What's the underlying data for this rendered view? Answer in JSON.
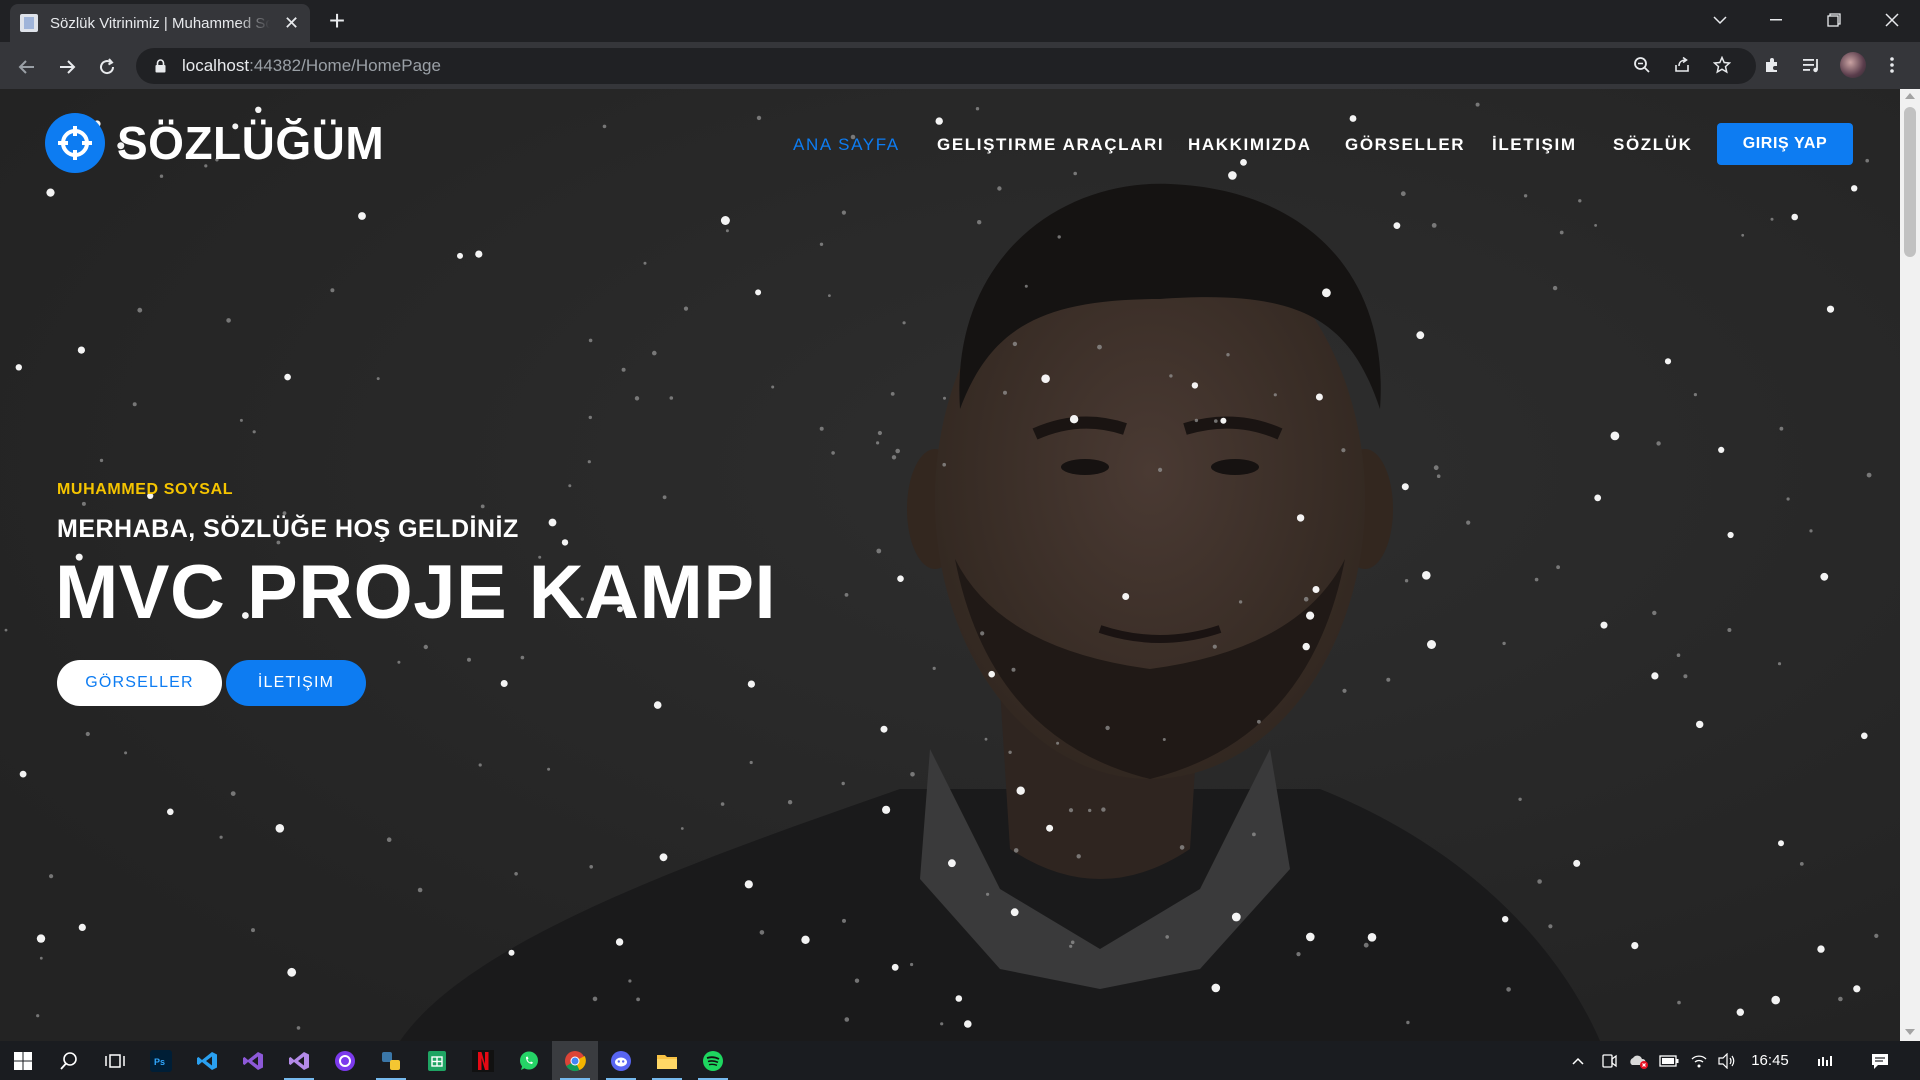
{
  "browser": {
    "tab_title": "Sözlük Vitrinimiz | Muhammed Soysal",
    "url_host": "localhost",
    "url_rest": ":44382/Home/HomePage"
  },
  "site": {
    "brand": "SÖZLÜĞÜM",
    "nav": [
      {
        "label": "ANA SAYFA",
        "active": true
      },
      {
        "label": "GELIŞTIRME ARAÇLARI",
        "active": false
      },
      {
        "label": "HAKKIMIZDA",
        "active": false
      },
      {
        "label": "GÖRSELLER",
        "active": false
      },
      {
        "label": "İLETIŞIM",
        "active": false
      },
      {
        "label": "SÖZLÜK",
        "active": false
      }
    ],
    "login_label": "GIRIŞ YAP",
    "colors": {
      "accent": "#0d7cf2",
      "eyebrow": "#f5c400"
    }
  },
  "hero": {
    "eyebrow": "MUHAMMED SOYSAL",
    "subtitle": "MERHABA, SÖZLÜĞE HOŞ GELDİNİZ",
    "title": "MVC PROJE KAMPI",
    "btn_gallery": "GÖRSELLER",
    "btn_contact": "İLETIŞIM"
  },
  "taskbar": {
    "apps": [
      "windows-start",
      "search",
      "task-view",
      "photoshop",
      "vscode",
      "visual-studio",
      "visual-studio-2",
      "github-desktop",
      "python",
      "sheets",
      "netflix",
      "whatsapp",
      "chrome",
      "discord",
      "file-explorer",
      "spotify"
    ],
    "time": "16:45"
  }
}
